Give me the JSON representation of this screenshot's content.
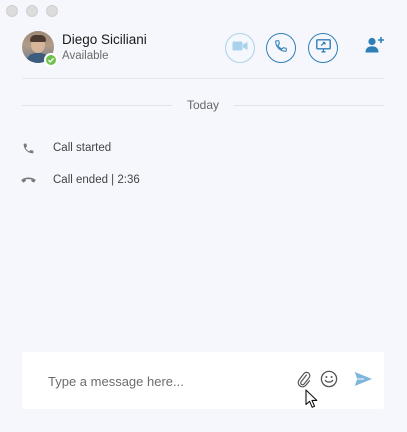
{
  "contact": {
    "name": "Diego Siciliani",
    "status": "Available",
    "presence_color": "#6cc24a"
  },
  "header": {
    "actions": [
      {
        "name": "video-call",
        "icon": "video-icon",
        "enabled": false
      },
      {
        "name": "audio-call",
        "icon": "phone-icon",
        "enabled": true
      },
      {
        "name": "share-screen",
        "icon": "screen-share-icon",
        "enabled": true
      },
      {
        "name": "add-people",
        "icon": "add-person-icon",
        "enabled": true
      }
    ]
  },
  "conversation": {
    "date_label": "Today",
    "events": [
      {
        "icon": "phone-icon",
        "text": "Call started"
      },
      {
        "icon": "phone-hangup-icon",
        "text": "Call ended | 2:36"
      }
    ]
  },
  "composer": {
    "placeholder": "Type a message here...",
    "value": ""
  },
  "theme": {
    "accent": "#2e7fb8",
    "accent_disabled": "#a9d3ec",
    "send": "#7fb6dc",
    "background": "#f5f7fc"
  }
}
